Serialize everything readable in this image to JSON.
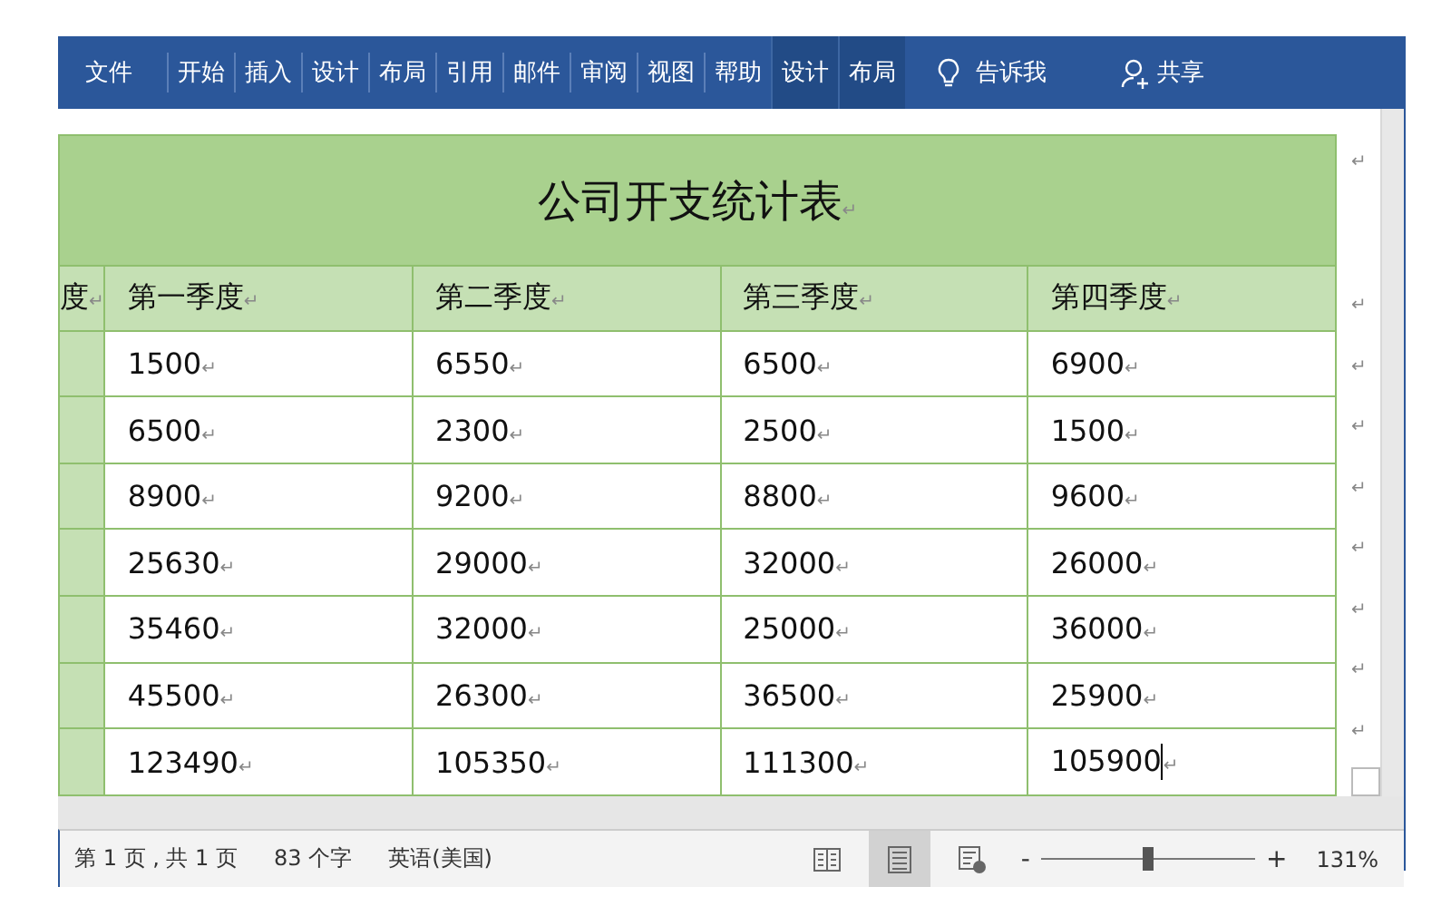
{
  "ribbon": {
    "tabs": [
      {
        "label": "文件",
        "kind": "file"
      },
      {
        "label": "开始",
        "kind": "tab"
      },
      {
        "label": "插入",
        "kind": "tab"
      },
      {
        "label": "设计",
        "kind": "tab"
      },
      {
        "label": "布局",
        "kind": "tab"
      },
      {
        "label": "引用",
        "kind": "tab"
      },
      {
        "label": "邮件",
        "kind": "tab"
      },
      {
        "label": "审阅",
        "kind": "tab"
      },
      {
        "label": "视图",
        "kind": "tab"
      },
      {
        "label": "帮助",
        "kind": "tab"
      },
      {
        "label": "设计",
        "kind": "context"
      },
      {
        "label": "布局",
        "kind": "context"
      }
    ],
    "tell_me": "告诉我",
    "share": "共享"
  },
  "table": {
    "title": {
      "text": "公司开支统计表",
      "mark": "↵",
      "end_mark": "↵"
    },
    "header": {
      "partial": {
        "text": "度",
        "mark": "↵"
      },
      "cells": [
        {
          "text": "第一季度",
          "mark": "↵"
        },
        {
          "text": "第二季度",
          "mark": "↵"
        },
        {
          "text": "第三季度",
          "mark": "↵"
        },
        {
          "text": "第四季度",
          "mark": "↵"
        }
      ],
      "end_mark": "↵"
    },
    "rows": [
      {
        "cells": [
          {
            "text": "1500",
            "mark": "↵",
            "caret": false
          },
          {
            "text": "6550",
            "mark": "↵",
            "caret": false
          },
          {
            "text": "6500",
            "mark": "↵",
            "caret": false
          },
          {
            "text": "6900",
            "mark": "↵",
            "caret": false
          }
        ],
        "end_mark": "↵"
      },
      {
        "cells": [
          {
            "text": "6500",
            "mark": "↵",
            "caret": false
          },
          {
            "text": "2300",
            "mark": "↵",
            "caret": false
          },
          {
            "text": "2500",
            "mark": "↵",
            "caret": false
          },
          {
            "text": "1500",
            "mark": "↵",
            "caret": false
          }
        ],
        "end_mark": "↵"
      },
      {
        "cells": [
          {
            "text": "8900",
            "mark": "↵",
            "caret": false
          },
          {
            "text": "9200",
            "mark": "↵",
            "caret": false
          },
          {
            "text": "8800",
            "mark": "↵",
            "caret": false
          },
          {
            "text": "9600",
            "mark": "↵",
            "caret": false
          }
        ],
        "end_mark": "↵"
      },
      {
        "cells": [
          {
            "text": "25630",
            "mark": "↵",
            "caret": false
          },
          {
            "text": "29000",
            "mark": "↵",
            "caret": false
          },
          {
            "text": "32000",
            "mark": "↵",
            "caret": false
          },
          {
            "text": "26000",
            "mark": "↵",
            "caret": false
          }
        ],
        "end_mark": "↵"
      },
      {
        "cells": [
          {
            "text": "35460",
            "mark": "↵",
            "caret": false
          },
          {
            "text": "32000",
            "mark": "↵",
            "caret": false
          },
          {
            "text": "25000",
            "mark": "↵",
            "caret": false
          },
          {
            "text": "36000",
            "mark": "↵",
            "caret": false
          }
        ],
        "end_mark": "↵"
      },
      {
        "cells": [
          {
            "text": "45500",
            "mark": "↵",
            "caret": false
          },
          {
            "text": "26300",
            "mark": "↵",
            "caret": false
          },
          {
            "text": "36500",
            "mark": "↵",
            "caret": false
          },
          {
            "text": "25900",
            "mark": "↵",
            "caret": false
          }
        ],
        "end_mark": "↵"
      },
      {
        "cells": [
          {
            "text": "123490",
            "mark": "↵",
            "caret": false
          },
          {
            "text": "105350",
            "mark": "↵",
            "caret": false
          },
          {
            "text": "111300",
            "mark": "↵",
            "caret": false
          },
          {
            "text": "105900",
            "mark": "↵",
            "caret": true
          }
        ],
        "end_mark": "↵"
      }
    ]
  },
  "status_bar": {
    "page": "第 1 页 , 共 1 页",
    "words": "83 个字",
    "language": "英语(美国)",
    "views": [
      {
        "kind": "read",
        "selected": false
      },
      {
        "kind": "print",
        "selected": true
      },
      {
        "kind": "web",
        "selected": false
      }
    ],
    "zoom_out": "-",
    "zoom": {
      "level": 0.5
    },
    "zoom_in": "+",
    "zoom_value": "131%"
  }
}
